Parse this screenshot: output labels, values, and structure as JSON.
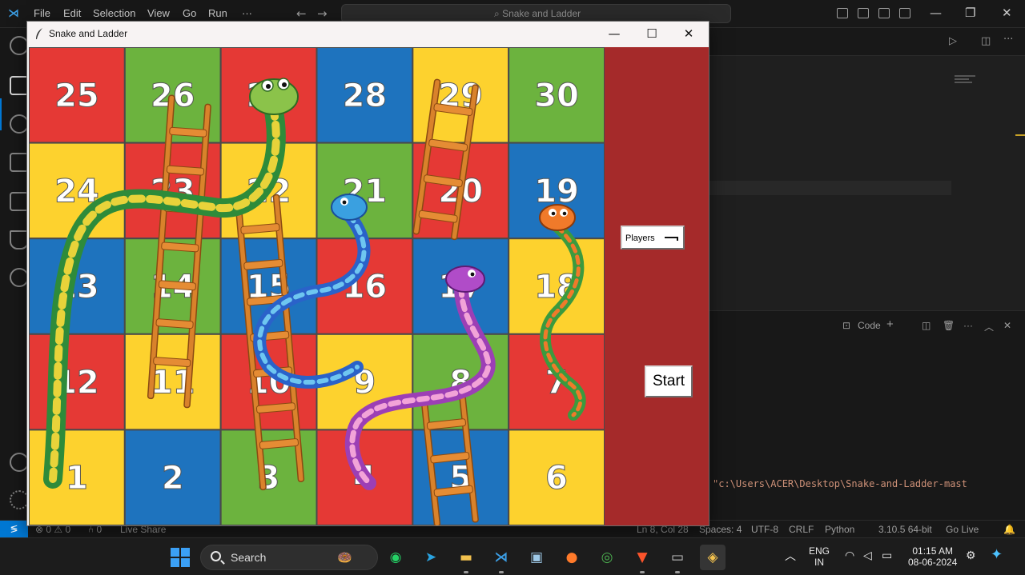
{
  "vscode": {
    "menu": [
      "File",
      "Edit",
      "Selection",
      "View",
      "Go",
      "Run",
      "···"
    ],
    "command_center": "Snake and Ladder",
    "panel": {
      "code_label": "Code",
      "terminal_line": "\"c:\\Users\\ACER\\Desktop\\Snake-and-Ladder-mast"
    },
    "status": {
      "problems": "⊗ 0 ⚠ 0",
      "ports": "⑃ 0",
      "live_share": "Live Share",
      "ln_col": "Ln 8, Col 28",
      "spaces": "Spaces: 4",
      "encoding": "UTF-8",
      "eol": "CRLF",
      "language": "Python",
      "interpreter": "3.10.5 64-bit",
      "go_live": "Go Live"
    }
  },
  "game_window": {
    "title": "Snake and Ladder",
    "minimize": "—",
    "maximize": "☐",
    "close": "✕",
    "players_label": "Players",
    "start_label": "Start"
  },
  "board": {
    "rows": [
      [
        {
          "n": "25",
          "c": "#e53935"
        },
        {
          "n": "26",
          "c": "#6cb33e"
        },
        {
          "n": "27",
          "c": "#e53935"
        },
        {
          "n": "28",
          "c": "#1e73be"
        },
        {
          "n": "29",
          "c": "#fdd22e"
        },
        {
          "n": "30",
          "c": "#6cb33e"
        }
      ],
      [
        {
          "n": "24",
          "c": "#fdd22e"
        },
        {
          "n": "23",
          "c": "#e53935"
        },
        {
          "n": "22",
          "c": "#fdd22e"
        },
        {
          "n": "21",
          "c": "#6cb33e"
        },
        {
          "n": "20",
          "c": "#e53935"
        },
        {
          "n": "19",
          "c": "#1e73be"
        }
      ],
      [
        {
          "n": "13",
          "c": "#1e73be"
        },
        {
          "n": "14",
          "c": "#6cb33e"
        },
        {
          "n": "15",
          "c": "#1e73be"
        },
        {
          "n": "16",
          "c": "#e53935"
        },
        {
          "n": "17",
          "c": "#1e73be"
        },
        {
          "n": "18",
          "c": "#fdd22e"
        }
      ],
      [
        {
          "n": "12",
          "c": "#e53935"
        },
        {
          "n": "11",
          "c": "#fdd22e"
        },
        {
          "n": "10",
          "c": "#e53935"
        },
        {
          "n": "9",
          "c": "#fdd22e"
        },
        {
          "n": "8",
          "c": "#6cb33e"
        },
        {
          "n": "7",
          "c": "#e53935"
        }
      ],
      [
        {
          "n": "1",
          "c": "#fdd22e"
        },
        {
          "n": "2",
          "c": "#1e73be"
        },
        {
          "n": "3",
          "c": "#6cb33e"
        },
        {
          "n": "4",
          "c": "#e53935"
        },
        {
          "n": "5",
          "c": "#1e73be"
        },
        {
          "n": "6",
          "c": "#fdd22e"
        }
      ]
    ]
  },
  "taskbar": {
    "search_placeholder": "Search",
    "lang_top": "ENG",
    "lang_bottom": "IN",
    "time": "01:15 AM",
    "date": "08-06-2024"
  },
  "colors": {
    "window_bg": "#a52a2a",
    "vscode_accent": "#0078d4"
  }
}
